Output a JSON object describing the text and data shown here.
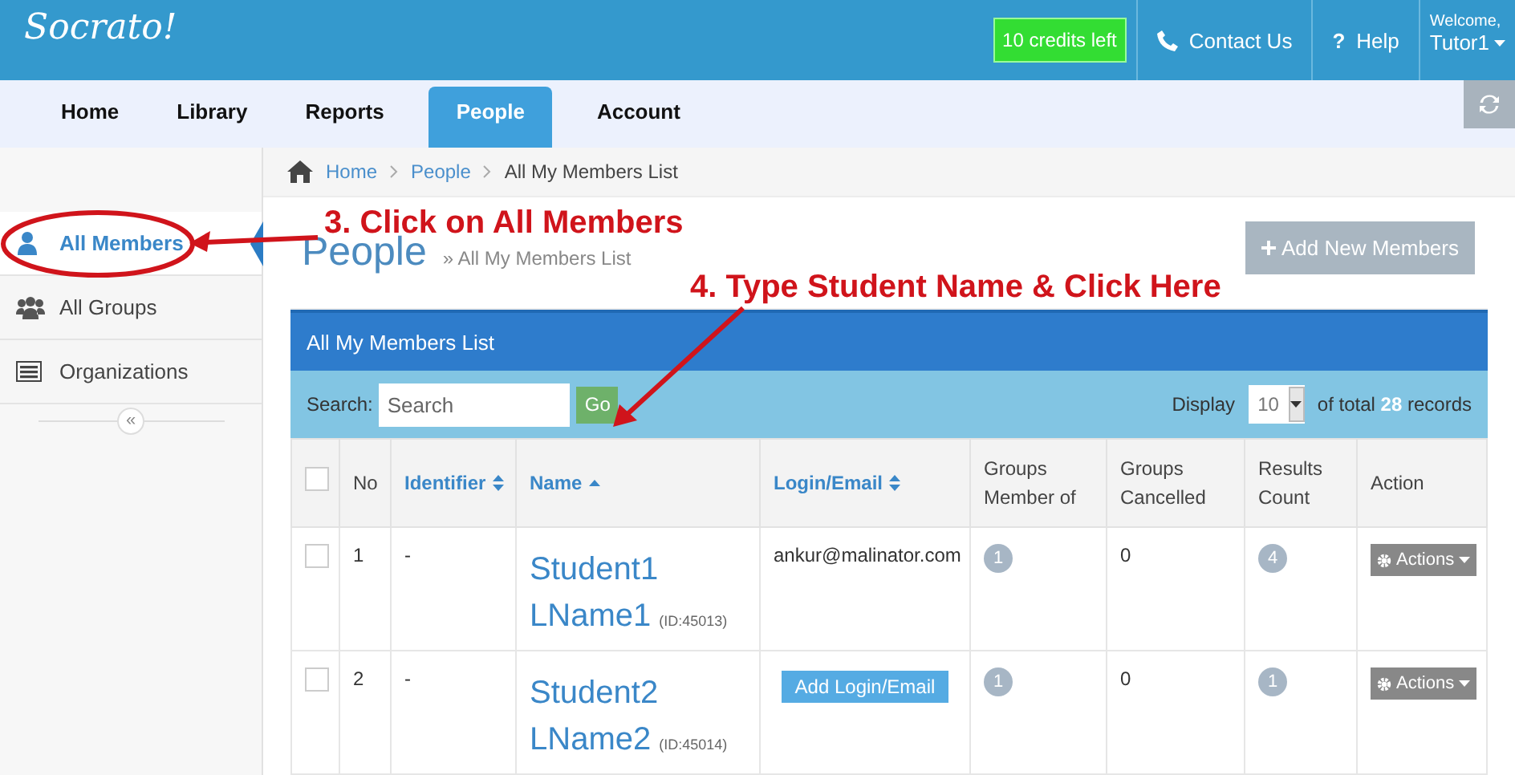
{
  "header": {
    "logo": "Socrato!",
    "credits": "10 credits left",
    "links": [
      {
        "kind": "phone",
        "label": "Contact Us"
      },
      {
        "kind": "glyph",
        "glyph": "?",
        "label": "Help"
      }
    ],
    "welcome": "Welcome,",
    "user": "Tutor1"
  },
  "nav": {
    "tabs": [
      {
        "label": "Home",
        "selected": false
      },
      {
        "label": "Library",
        "selected": false
      },
      {
        "label": "Reports",
        "selected": false
      },
      {
        "label": "People",
        "selected": true
      },
      {
        "label": "Account",
        "selected": false
      }
    ]
  },
  "sidebar": {
    "items": [
      {
        "label": "All Members",
        "kind": "person",
        "selected": true
      },
      {
        "label": "All Groups",
        "kind": "group",
        "selected": false
      },
      {
        "label": "Organizations",
        "kind": "list",
        "selected": false
      }
    ],
    "collapse": "«"
  },
  "breadcrumb": [
    "Home",
    "People",
    "All My Members List"
  ],
  "page": {
    "title": "People",
    "subtitle": "» All My Members List",
    "add_button": "Add New Members"
  },
  "panel": {
    "title": "All My Members List",
    "search_label": "Search:",
    "search_placeholder": "Search",
    "go": "Go",
    "display_label": "Display",
    "display_value": "10",
    "total_prefix": "of total",
    "total": "28",
    "total_suffix": "records"
  },
  "table": {
    "columns": [
      {
        "kind": "checkbox",
        "checked": false
      },
      {
        "kind": "plain",
        "label": "No"
      },
      {
        "kind": "sort-both",
        "label": "Identifier"
      },
      {
        "kind": "sort-asc",
        "label": "Name"
      },
      {
        "kind": "sort-both",
        "label": "Login/Email"
      },
      {
        "kind": "plain",
        "label": "Groups Member of"
      },
      {
        "kind": "plain",
        "label": "Groups Cancelled"
      },
      {
        "kind": "plain",
        "label": "Results Count"
      },
      {
        "kind": "plain",
        "label": "Action"
      }
    ],
    "rows": [
      {
        "checked": false,
        "no": "1",
        "identifier": "-",
        "first": "Student1",
        "last": "LName1",
        "id": "(ID:45013)",
        "login": {
          "kind": "text",
          "text": "ankur@malinator.com"
        },
        "groups_member": "1",
        "groups_cancelled": "0",
        "results": "4",
        "action": "Actions"
      },
      {
        "checked": false,
        "no": "2",
        "identifier": "-",
        "first": "Student2",
        "last": "LName2",
        "id": "(ID:45014)",
        "login": {
          "kind": "button",
          "text": "Add Login/Email"
        },
        "groups_member": "1",
        "groups_cancelled": "0",
        "results": "1",
        "action": "Actions"
      }
    ]
  },
  "annotations": [
    {
      "kind": "ellipse-arrow",
      "text": "3. Click on All Members"
    },
    {
      "kind": "arrow",
      "text": "4. Type Student Name & Click Here"
    }
  ]
}
